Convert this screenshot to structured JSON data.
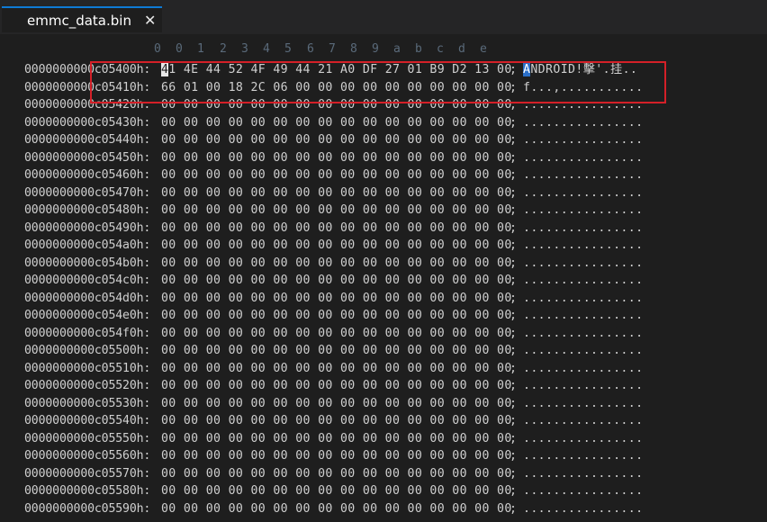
{
  "tab": {
    "title": "emmc_data.bin",
    "close_glyph": "✕"
  },
  "hex_header": [
    "0",
    "0",
    "1",
    "2",
    "3",
    "4",
    "5",
    "6",
    "7",
    "8",
    "9",
    "a",
    "b",
    "c",
    "d",
    "e"
  ],
  "rows": [
    {
      "addr": "0000000000c05400h:",
      "hex_first": "4",
      "hex_rest": "1 4E 44 52 4F 49 44 21 A0 DF 27 01 B9 D2 13 00",
      "ascii_first": "A",
      "ascii_rest": "NDROID!擊'.挂.."
    },
    {
      "addr": "0000000000c05410h:",
      "hex": "66 01 00 18 2C 06 00 00 00 00 00 00 00 00 00 00",
      "ascii": "f...,..........."
    },
    {
      "addr": "0000000000c05420h:",
      "hex": "00 00 00 00 00 00 00 00 00 00 00 00 00 00 00 00",
      "ascii": "................"
    },
    {
      "addr": "0000000000c05430h:",
      "hex": "00 00 00 00 00 00 00 00 00 00 00 00 00 00 00 00",
      "ascii": "................"
    },
    {
      "addr": "0000000000c05440h:",
      "hex": "00 00 00 00 00 00 00 00 00 00 00 00 00 00 00 00",
      "ascii": "................"
    },
    {
      "addr": "0000000000c05450h:",
      "hex": "00 00 00 00 00 00 00 00 00 00 00 00 00 00 00 00",
      "ascii": "................"
    },
    {
      "addr": "0000000000c05460h:",
      "hex": "00 00 00 00 00 00 00 00 00 00 00 00 00 00 00 00",
      "ascii": "................"
    },
    {
      "addr": "0000000000c05470h:",
      "hex": "00 00 00 00 00 00 00 00 00 00 00 00 00 00 00 00",
      "ascii": "................"
    },
    {
      "addr": "0000000000c05480h:",
      "hex": "00 00 00 00 00 00 00 00 00 00 00 00 00 00 00 00",
      "ascii": "................"
    },
    {
      "addr": "0000000000c05490h:",
      "hex": "00 00 00 00 00 00 00 00 00 00 00 00 00 00 00 00",
      "ascii": "................"
    },
    {
      "addr": "0000000000c054a0h:",
      "hex": "00 00 00 00 00 00 00 00 00 00 00 00 00 00 00 00",
      "ascii": "................"
    },
    {
      "addr": "0000000000c054b0h:",
      "hex": "00 00 00 00 00 00 00 00 00 00 00 00 00 00 00 00",
      "ascii": "................"
    },
    {
      "addr": "0000000000c054c0h:",
      "hex": "00 00 00 00 00 00 00 00 00 00 00 00 00 00 00 00",
      "ascii": "................"
    },
    {
      "addr": "0000000000c054d0h:",
      "hex": "00 00 00 00 00 00 00 00 00 00 00 00 00 00 00 00",
      "ascii": "................"
    },
    {
      "addr": "0000000000c054e0h:",
      "hex": "00 00 00 00 00 00 00 00 00 00 00 00 00 00 00 00",
      "ascii": "................"
    },
    {
      "addr": "0000000000c054f0h:",
      "hex": "00 00 00 00 00 00 00 00 00 00 00 00 00 00 00 00",
      "ascii": "................"
    },
    {
      "addr": "0000000000c05500h:",
      "hex": "00 00 00 00 00 00 00 00 00 00 00 00 00 00 00 00",
      "ascii": "................"
    },
    {
      "addr": "0000000000c05510h:",
      "hex": "00 00 00 00 00 00 00 00 00 00 00 00 00 00 00 00",
      "ascii": "................"
    },
    {
      "addr": "0000000000c05520h:",
      "hex": "00 00 00 00 00 00 00 00 00 00 00 00 00 00 00 00",
      "ascii": "................"
    },
    {
      "addr": "0000000000c05530h:",
      "hex": "00 00 00 00 00 00 00 00 00 00 00 00 00 00 00 00",
      "ascii": "................"
    },
    {
      "addr": "0000000000c05540h:",
      "hex": "00 00 00 00 00 00 00 00 00 00 00 00 00 00 00 00",
      "ascii": "................"
    },
    {
      "addr": "0000000000c05550h:",
      "hex": "00 00 00 00 00 00 00 00 00 00 00 00 00 00 00 00",
      "ascii": "................"
    },
    {
      "addr": "0000000000c05560h:",
      "hex": "00 00 00 00 00 00 00 00 00 00 00 00 00 00 00 00",
      "ascii": "................"
    },
    {
      "addr": "0000000000c05570h:",
      "hex": "00 00 00 00 00 00 00 00 00 00 00 00 00 00 00 00",
      "ascii": "................"
    },
    {
      "addr": "0000000000c05580h:",
      "hex": "00 00 00 00 00 00 00 00 00 00 00 00 00 00 00 00",
      "ascii": "................"
    },
    {
      "addr": "0000000000c05590h:",
      "hex": "00 00 00 00 00 00 00 00 00 00 00 00 00 00 00 00",
      "ascii": "................"
    }
  ],
  "separator": ";",
  "colors": {
    "highlight_box": "#d42028",
    "tab_accent": "#0e7ad4",
    "selection": "#2a6fc9"
  }
}
